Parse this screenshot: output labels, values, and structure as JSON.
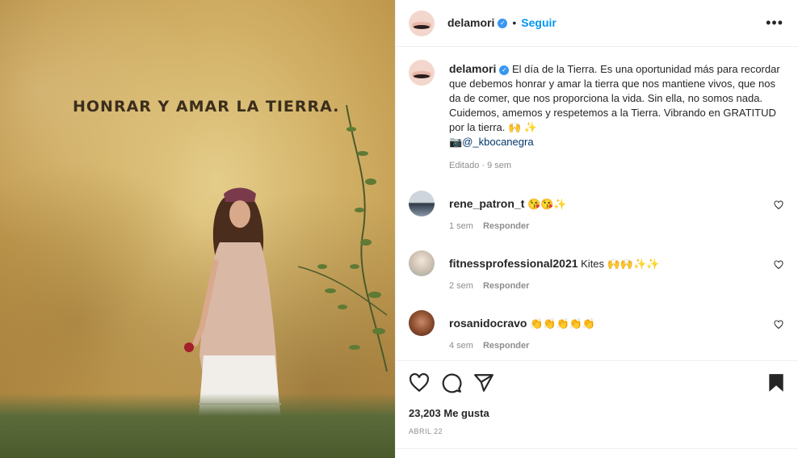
{
  "post": {
    "username": "delamori",
    "follow_label": "Seguir",
    "separator": "•",
    "more_label": "•••",
    "image": {
      "headline": "HONRAR Y AMAR LA TIERRA."
    },
    "caption": {
      "username": "delamori",
      "text": "El día de la Tierra. Es una oportunidad más para recordar que debemos honrar y amar la tierra que nos mantiene vivos, que nos da de comer, que nos proporciona la vida. Sin ella, no somos nada. Cuidemos, amemos y respetemos a la Tierra. Vibrando en GRATITUD por la tierra.",
      "emojis": "🙌 ✨",
      "camera": "📷",
      "mention": "@_kbocanegra",
      "meta": "Editado · 9 sem"
    },
    "comments": [
      {
        "username": "rene_patron_t",
        "text": "😘😘✨",
        "time": "1 sem",
        "reply": "Responder"
      },
      {
        "username": "fitnessprofessional2021",
        "text": "Kites 🙌🙌✨✨",
        "time": "2 sem",
        "reply": "Responder"
      },
      {
        "username": "rosanidocravo",
        "text": "👏👏👏👏👏",
        "time": "4 sem",
        "reply": "Responder"
      }
    ],
    "likes": "23,203 Me gusta",
    "date": "ABRIL 22"
  },
  "colors": {
    "link": "#0095f6",
    "mention": "#00376b",
    "muted": "#8e8e8e",
    "text": "#262626"
  },
  "icons": {
    "like": "heart-icon",
    "comment": "comment-bubble-icon",
    "share": "paper-plane-icon",
    "save": "bookmark-icon",
    "more": "more-dots-icon",
    "verified": "verified-badge-icon"
  }
}
